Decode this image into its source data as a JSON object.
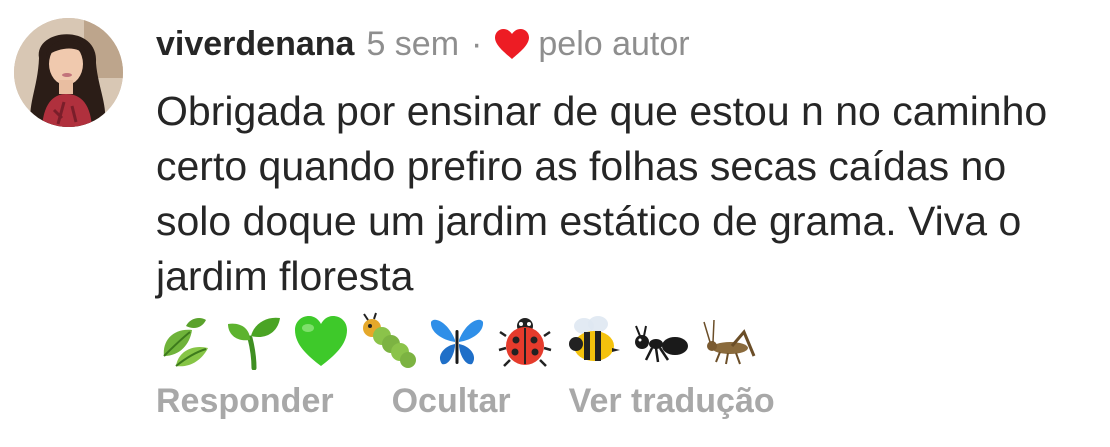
{
  "comment": {
    "username": "viverdenana",
    "time": "5 sem",
    "separator": "·",
    "liked_by": "pelo autor",
    "text": "Obrigada por ensinar de que estou n no caminho certo quando prefiro as folhas secas caídas no solo doque um jardim estático de grama. Viva o jardim floresta",
    "emojis": [
      "leaves-emoji",
      "seedling-emoji",
      "green-heart-emoji",
      "bug-emoji",
      "butterfly-emoji",
      "ladybug-emoji",
      "bee-emoji",
      "ant-emoji",
      "cricket-emoji"
    ]
  },
  "actions": {
    "reply": "Responder",
    "hide": "Ocultar",
    "translate": "Ver tradução"
  },
  "colors": {
    "text": "#262626",
    "muted": "#8e8e8e",
    "action": "#a8a8a8",
    "heart": "#ed1c24"
  }
}
